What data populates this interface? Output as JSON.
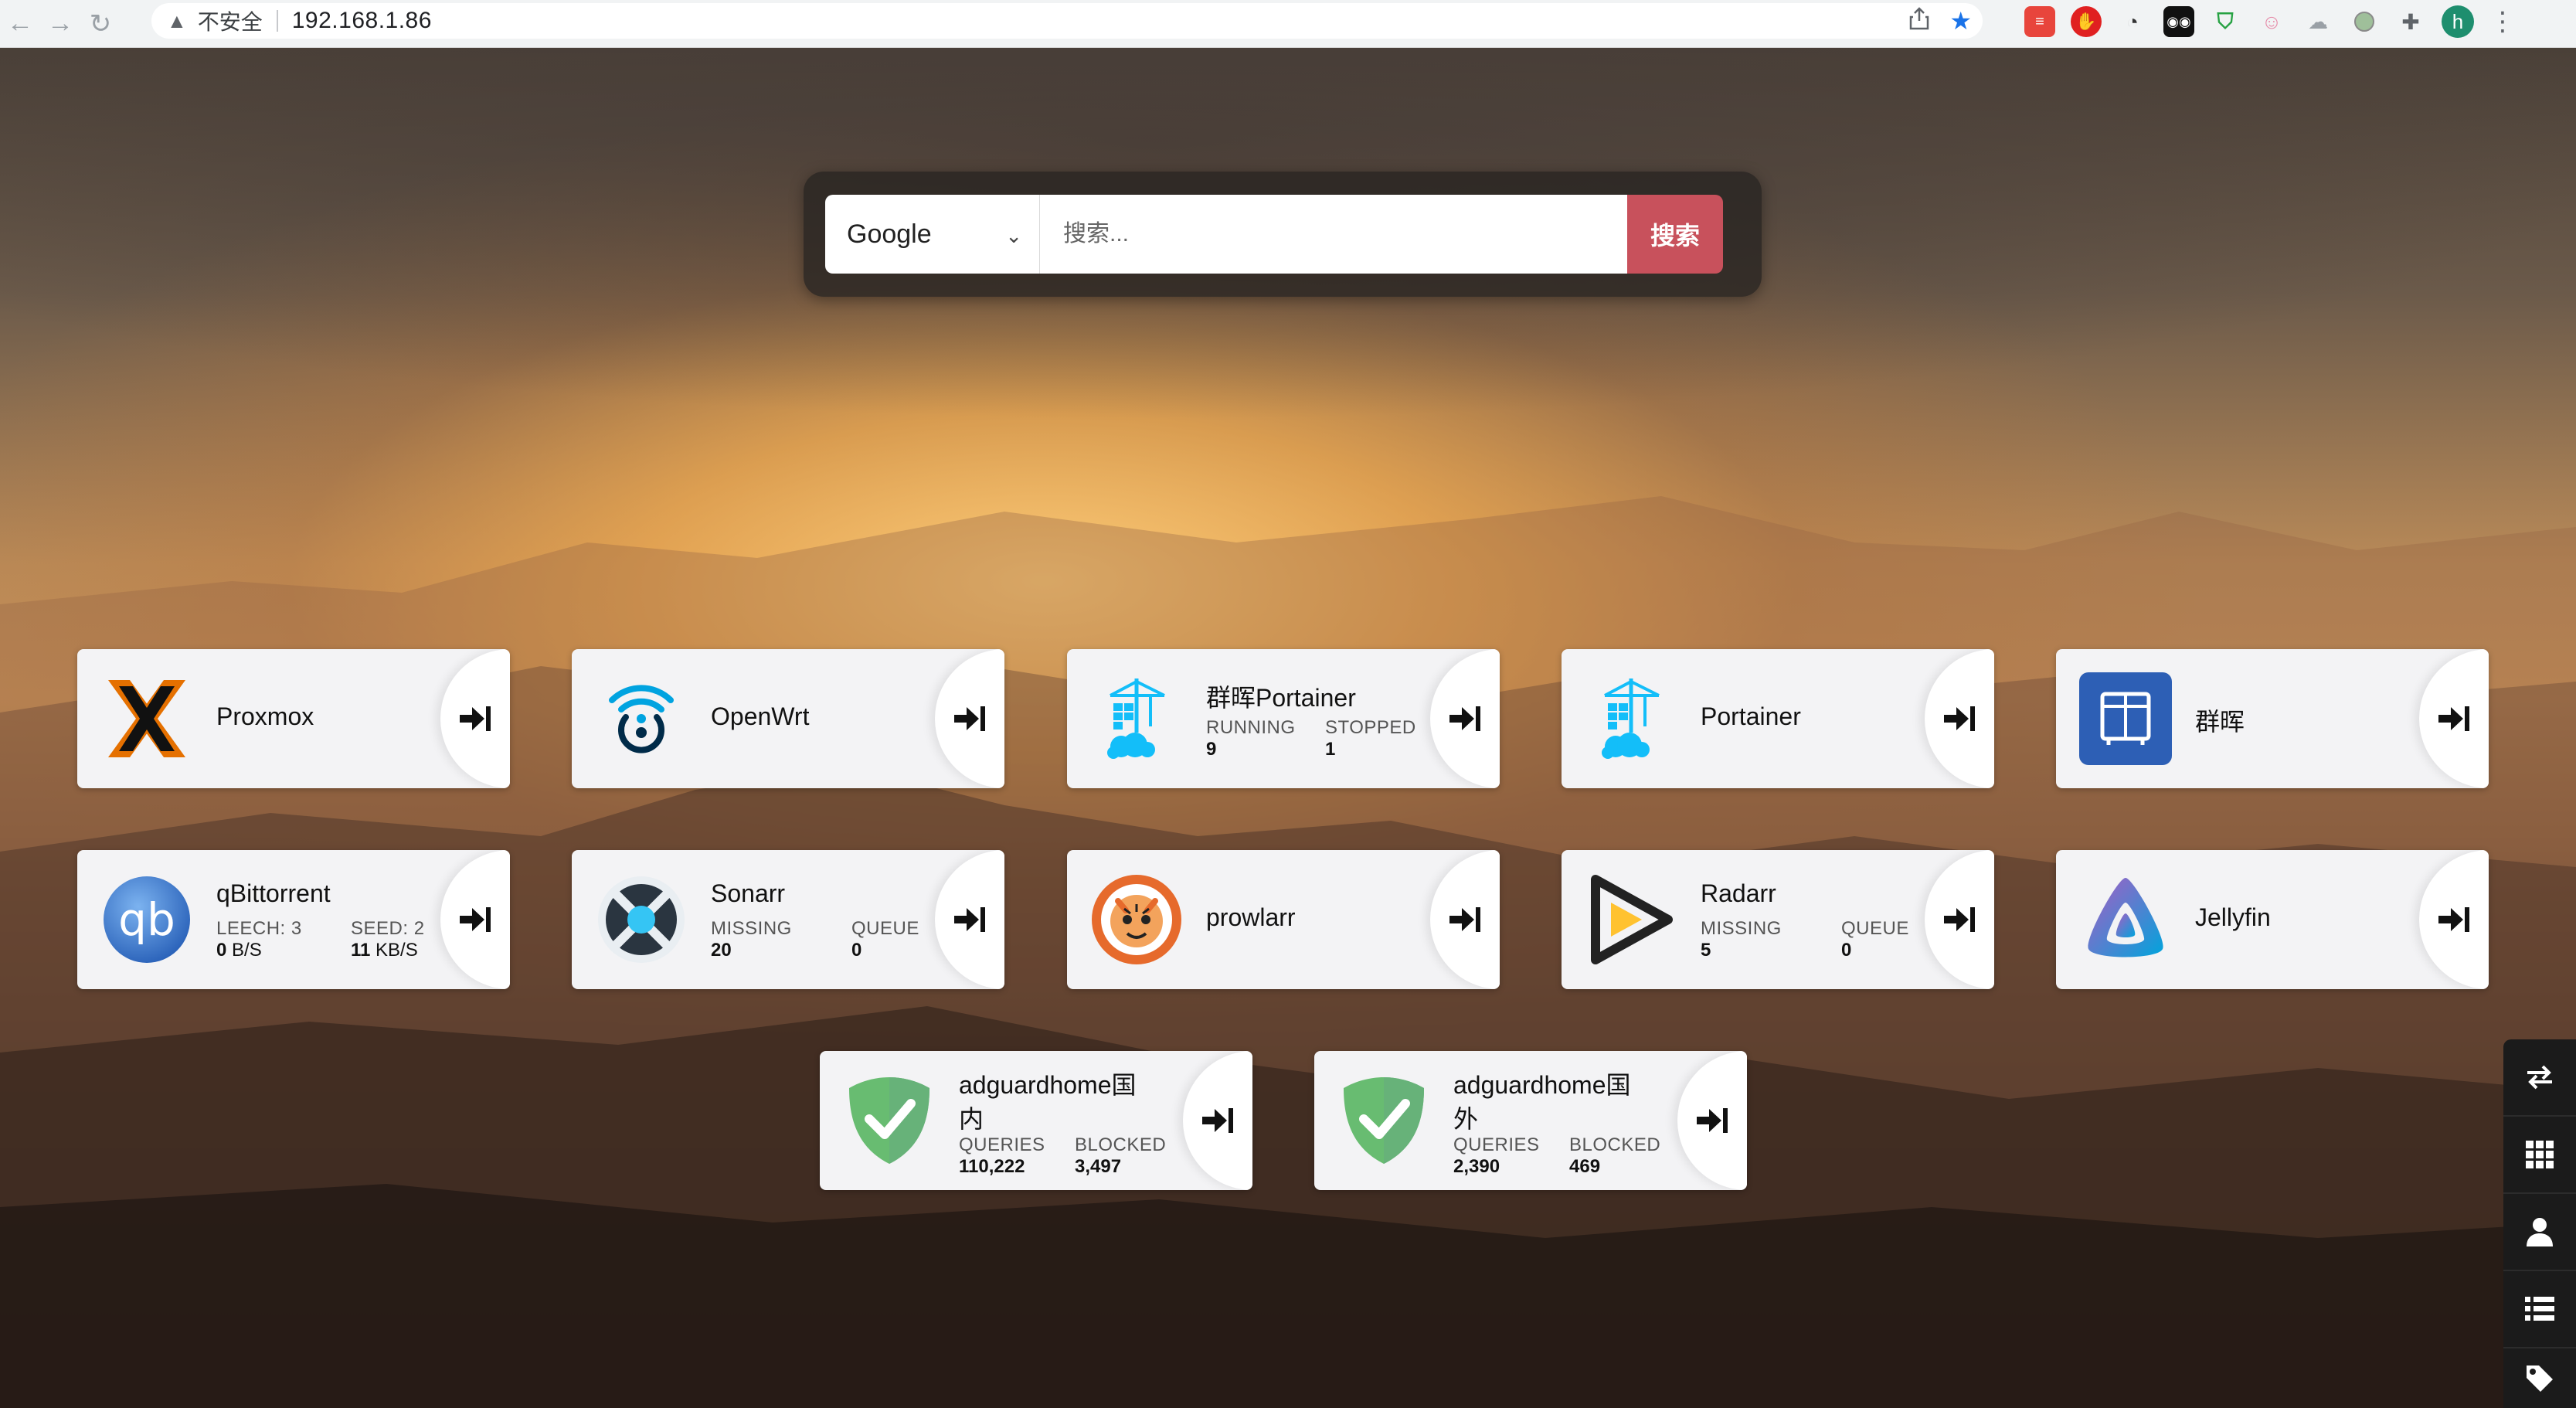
{
  "browser": {
    "security_label": "不安全",
    "url": "192.168.1.86",
    "avatar_letter": "h"
  },
  "search": {
    "engine": "Google",
    "placeholder": "搜索...",
    "button_label": "搜索"
  },
  "tiles": [
    {
      "title": "Proxmox"
    },
    {
      "title": "OpenWrt"
    },
    {
      "title": "群晖Portainer",
      "stats": [
        {
          "label": "RUNNING",
          "value": "9"
        },
        {
          "label": "STOPPED",
          "value": "1"
        }
      ]
    },
    {
      "title": "Portainer"
    },
    {
      "title": "群晖"
    },
    {
      "title": "qBittorrent",
      "stats": [
        {
          "label": "LEECH: 3",
          "value": "0",
          "unit": " B/S"
        },
        {
          "label": "SEED: 2",
          "value": "11",
          "unit": " KB/S"
        }
      ]
    },
    {
      "title": "Sonarr",
      "stats": [
        {
          "label": "MISSING",
          "value": "20"
        },
        {
          "label": "QUEUE",
          "value": "0"
        }
      ]
    },
    {
      "title": "prowlarr"
    },
    {
      "title": "Radarr",
      "stats": [
        {
          "label": "MISSING",
          "value": "5"
        },
        {
          "label": "QUEUE",
          "value": "0"
        }
      ]
    },
    {
      "title": "Jellyfin"
    },
    {
      "title": "adguardhome国内",
      "stats": [
        {
          "label": "QUERIES",
          "value": "110,222"
        },
        {
          "label": "BLOCKED",
          "value": "3,497"
        }
      ]
    },
    {
      "title": "adguardhome国外",
      "stats": [
        {
          "label": "QUERIES",
          "value": "2,390"
        },
        {
          "label": "BLOCKED",
          "value": "469"
        }
      ]
    }
  ],
  "dock": {
    "items": [
      "switch-icon",
      "apps-grid-icon",
      "user-icon",
      "list-icon",
      "tag-icon"
    ]
  },
  "colors": {
    "search_button": "#c8515c",
    "dock_background": "#1b1b1b",
    "tile_background": "#f3f3f5"
  }
}
